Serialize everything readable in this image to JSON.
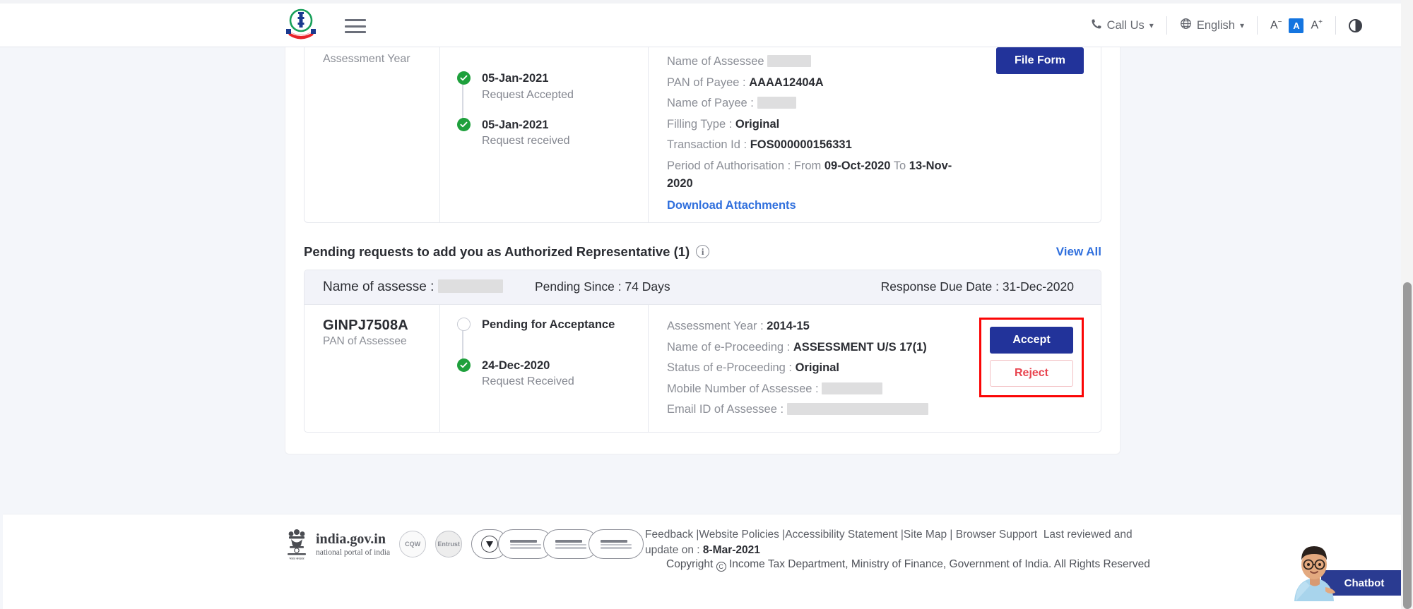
{
  "header": {
    "logo_alt": "Income Tax Department Government of India",
    "menu_label": "Menu",
    "call_us": "Call Us",
    "language": "English",
    "font_decrease": "A",
    "font_normal": "A",
    "font_increase": "A",
    "contrast_label": "Contrast"
  },
  "card_top": {
    "column_label": "Assessment Year",
    "timeline": [
      {
        "date": "05-Jan-2021",
        "status": "Request Accepted",
        "state": "done"
      },
      {
        "date": "05-Jan-2021",
        "status": "Request received",
        "state": "done"
      }
    ],
    "details": [
      {
        "label": "Name of Assessee",
        "value": "",
        "redacted": true,
        "redact_width": 62
      },
      {
        "label": "PAN of Payee :",
        "value": "AAAA12404A"
      },
      {
        "label": "Name of Payee :",
        "value": "",
        "redacted": true,
        "redact_width": 55
      },
      {
        "label": "Filling Type :",
        "value": "Original"
      },
      {
        "label": "Transaction Id :",
        "value": "FOS000000156331"
      }
    ],
    "period_label": "Period of Authorisation : From",
    "period_from": "09-Oct-2020",
    "period_to_label": "To",
    "period_to": "13-Nov-2020",
    "download_link": "Download Attachments",
    "file_form_button": "File Form"
  },
  "section": {
    "title": "Pending requests to add you as Authorized Representative (1)",
    "info_icon": "info-icon",
    "view_all": "View All"
  },
  "pending": {
    "summary": {
      "name_label": "Name of assesse :",
      "name_value": "",
      "pending_since": "Pending Since : 74 Days",
      "response_due": "Response Due Date : 31-Dec-2020"
    },
    "pan": "GINPJ7508A",
    "pan_caption": "PAN of Assessee",
    "timeline": [
      {
        "date": "",
        "status": "Pending for Acceptance",
        "state": "open"
      },
      {
        "date": "24-Dec-2020",
        "status": "Request Received",
        "state": "done"
      }
    ],
    "details": [
      {
        "label": "Assessment Year :",
        "value": "2014-15"
      },
      {
        "label": "Name of e-Proceeding :",
        "value": "ASSESSMENT U/S 17(1)"
      },
      {
        "label": "Status of e-Proceeding :",
        "value": "Original"
      },
      {
        "label": "Mobile Number of Assessee :",
        "value": "",
        "redacted": true,
        "redact_width": 86
      },
      {
        "label": "Email ID of Assessee :",
        "value": "",
        "redacted": true,
        "redact_width": 200
      }
    ],
    "accept_button": "Accept",
    "reject_button": "Reject"
  },
  "footer": {
    "india_gov_title": "india.gov.in",
    "india_gov_sub": "national portal of india",
    "seal_cqw": "CQW",
    "seal_entrust": "Entrust",
    "links": [
      "Feedback",
      "Website Policies",
      "Accessibility Statement",
      "Site Map",
      "Browser Support"
    ],
    "last_reviewed": "Last reviewed and update on :",
    "last_reviewed_date": "8-Mar-2021",
    "copyright": "Copyright",
    "copyright_text": "Income Tax Department, Ministry of Finance, Government of India. All Rights Reserved"
  },
  "chatbot": {
    "label": "Chatbot"
  },
  "colors": {
    "primary_navy": "#22339a",
    "link_blue": "#2f6fdd",
    "success_green": "#1ea03c",
    "reject_red": "#e8444f",
    "highlight_red": "#fb0505",
    "page_bg": "#f4f6fa"
  }
}
